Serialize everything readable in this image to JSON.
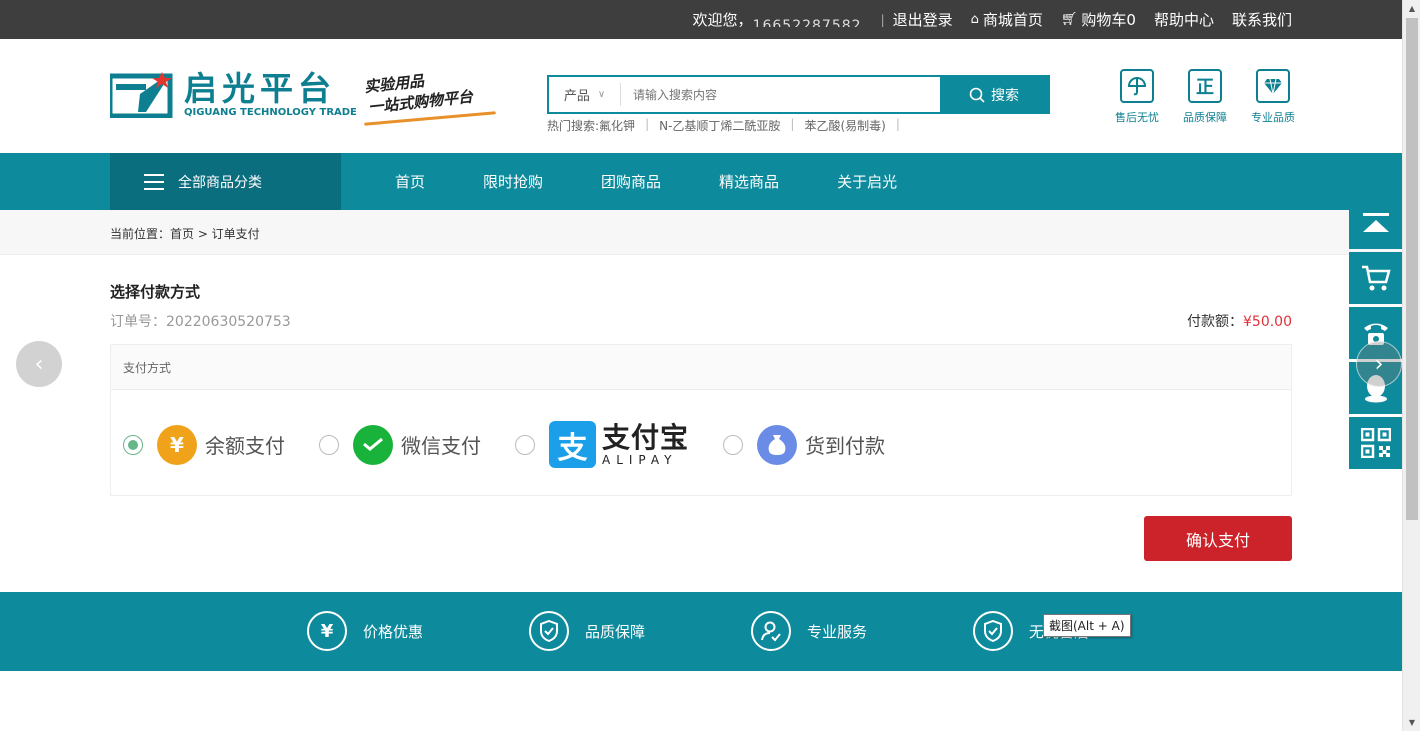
{
  "topbar": {
    "welcome": "欢迎您，",
    "username_masked": "16652287582",
    "logout": "退出登录",
    "home": "商城首页",
    "cart": "购物车0",
    "help": "帮助中心",
    "contact": "联系我们"
  },
  "logo": {
    "cn": "启光平台",
    "en": "QIGUANG TECHNOLOGY TRADE"
  },
  "slogan": {
    "line1": "实验用品",
    "line2": "一站式购物平台"
  },
  "search": {
    "category": "产品",
    "placeholder": "请输入搜索内容",
    "button": "搜索",
    "hot_label": "热门搜索:",
    "hot_items": [
      "氟化钾",
      "N-乙基顺丁烯二酰亚胺",
      "苯乙酸(易制毒)"
    ]
  },
  "badges": [
    {
      "icon": "umbrella-icon",
      "label": "售后无忧"
    },
    {
      "icon": "zheng-icon",
      "label": "品质保障",
      "glyph": "正"
    },
    {
      "icon": "diamond-icon",
      "label": "专业品质"
    }
  ],
  "nav": {
    "all_categories": "全部商品分类",
    "links": [
      "首页",
      "限时抢购",
      "团购商品",
      "精选商品",
      "关于启光"
    ]
  },
  "breadcrumb": "当前位置：首页 > 订单支付",
  "payment": {
    "title": "选择付款方式",
    "order_label": "订单号：",
    "order_no": "20220630520753",
    "amount_label": "付款额：",
    "amount_value": "¥50.00",
    "section_header": "支付方式",
    "options": [
      {
        "id": "balance",
        "label": "余额支付",
        "selected": true,
        "glyph": "¥",
        "color": "#f0a31a"
      },
      {
        "id": "wechat",
        "label": "微信支付",
        "selected": false,
        "color": "#19b23b"
      },
      {
        "id": "alipay",
        "label_cn": "支付宝",
        "label_en": "ALIPAY",
        "glyph": "支",
        "selected": false,
        "color": "#1a9fe8"
      },
      {
        "id": "cod",
        "label": "货到付款",
        "selected": false,
        "color": "#6b8ce6"
      }
    ],
    "confirm": "确认支付"
  },
  "footer_band": {
    "items": [
      {
        "icon": "yen-circle-icon",
        "glyph": "¥",
        "label": "价格优惠"
      },
      {
        "icon": "shield-icon",
        "label": "品质保障"
      },
      {
        "icon": "service-icon",
        "label": "专业服务"
      },
      {
        "icon": "shield-check-icon",
        "label": "无忧售后"
      }
    ],
    "tooltip": "截图(Alt + A)"
  },
  "colors": {
    "primary": "#0d8a9c",
    "dark_primary": "#0b6e7e",
    "confirm": "#cc2229",
    "price": "#e0313a"
  }
}
